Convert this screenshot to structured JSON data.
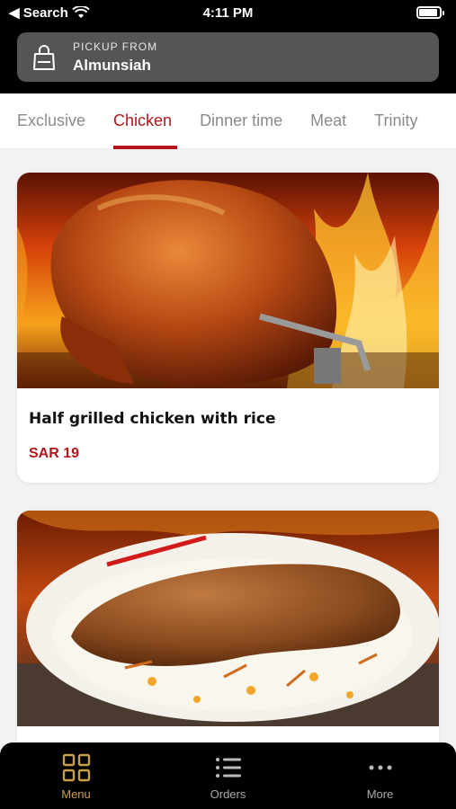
{
  "status_bar": {
    "back_label": "◀ Search",
    "time": "4:11 PM"
  },
  "header": {
    "pickup_label": "PICKUP FROM",
    "pickup_value": "Almunsiah"
  },
  "tabs": [
    {
      "label": "Exclusive",
      "active": false
    },
    {
      "label": "Chicken",
      "active": true
    },
    {
      "label": "Dinner time",
      "active": false
    },
    {
      "label": "Meat",
      "active": false
    },
    {
      "label": "Trinity",
      "active": false
    }
  ],
  "items": [
    {
      "title": "Half grilled chicken with rice",
      "price": "SAR 19"
    },
    {
      "title": "",
      "price": ""
    }
  ],
  "bottom_nav": [
    {
      "label": "Menu",
      "icon": "grid-icon",
      "active": true
    },
    {
      "label": "Orders",
      "icon": "list-icon",
      "active": false
    },
    {
      "label": "More",
      "icon": "more-icon",
      "active": false
    }
  ],
  "colors": {
    "accent": "#b3151b",
    "nav_active": "#c9a04a"
  }
}
